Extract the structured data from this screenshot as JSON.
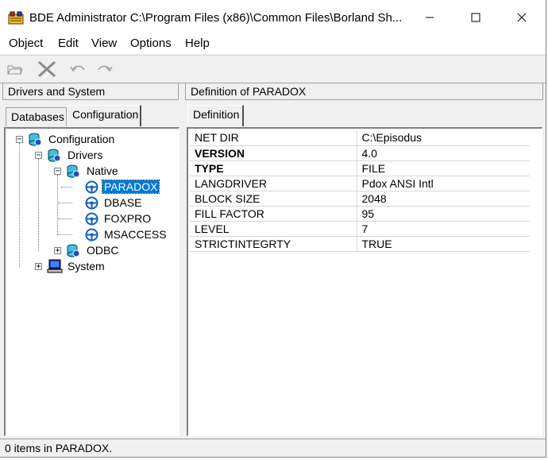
{
  "window": {
    "title": "BDE Administrator  C:\\Program Files (x86)\\Common Files\\Borland Sh...",
    "icon": "bde-app-icon",
    "controls": [
      "minimize-icon",
      "maximize-icon",
      "close-icon"
    ]
  },
  "menu": [
    "Object",
    "Edit",
    "View",
    "Options",
    "Help"
  ],
  "toolbar": [
    "open-folder-icon",
    "delete-x-icon",
    "undo-icon",
    "redo-icon"
  ],
  "left_panel": {
    "header": "Drivers and System",
    "tabs": [
      "Databases",
      "Configuration"
    ],
    "active_tab": "Configuration",
    "tree": {
      "root": "Configuration",
      "drivers": "Drivers",
      "native": "Native",
      "native_items": [
        "PARADOX",
        "DBASE",
        "FOXPRO",
        "MSACCESS"
      ],
      "odbc": "ODBC",
      "system": "System",
      "selected": "PARADOX"
    }
  },
  "right_panel": {
    "header": "Definition of PARADOX",
    "tab": "Definition",
    "rows": [
      {
        "key": "NET DIR",
        "value": "C:\\Episodus",
        "bold": false
      },
      {
        "key": "VERSION",
        "value": "4.0",
        "bold": true
      },
      {
        "key": "TYPE",
        "value": "FILE",
        "bold": true
      },
      {
        "key": "LANGDRIVER",
        "value": "Pdox ANSI Intl",
        "bold": false
      },
      {
        "key": "BLOCK SIZE",
        "value": "2048",
        "bold": false
      },
      {
        "key": "FILL FACTOR",
        "value": "95",
        "bold": false
      },
      {
        "key": "LEVEL",
        "value": "7",
        "bold": false
      },
      {
        "key": "STRICTINTEGRTY",
        "value": "TRUE",
        "bold": false
      }
    ]
  },
  "status": "0 items in PARADOX.",
  "colors": {
    "selection": "#0078d7",
    "driver_icon": "#1060c0"
  }
}
